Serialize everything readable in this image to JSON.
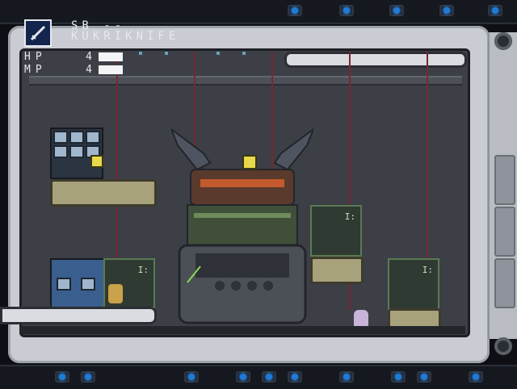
{
  "hud": {
    "weapon_icon": "knife-icon",
    "weapon_line1": "SB --",
    "weapon_line2": "KUKRIKNIFE",
    "hp_label": "HP",
    "hp_value": "4",
    "hp_fill": 1.0,
    "mp_label": "MP",
    "mp_value": "4",
    "mp_fill": 1.0
  },
  "scene": {
    "boss": "mechanical-core-boss",
    "player": "player-character",
    "ally": "ally-character",
    "marker_icon": "arrow-down-icon"
  },
  "colors": {
    "frame": "#c9ccd2",
    "room": "#3c3f46",
    "bar": "#f2f4f6",
    "light": "#1f7bd8"
  }
}
